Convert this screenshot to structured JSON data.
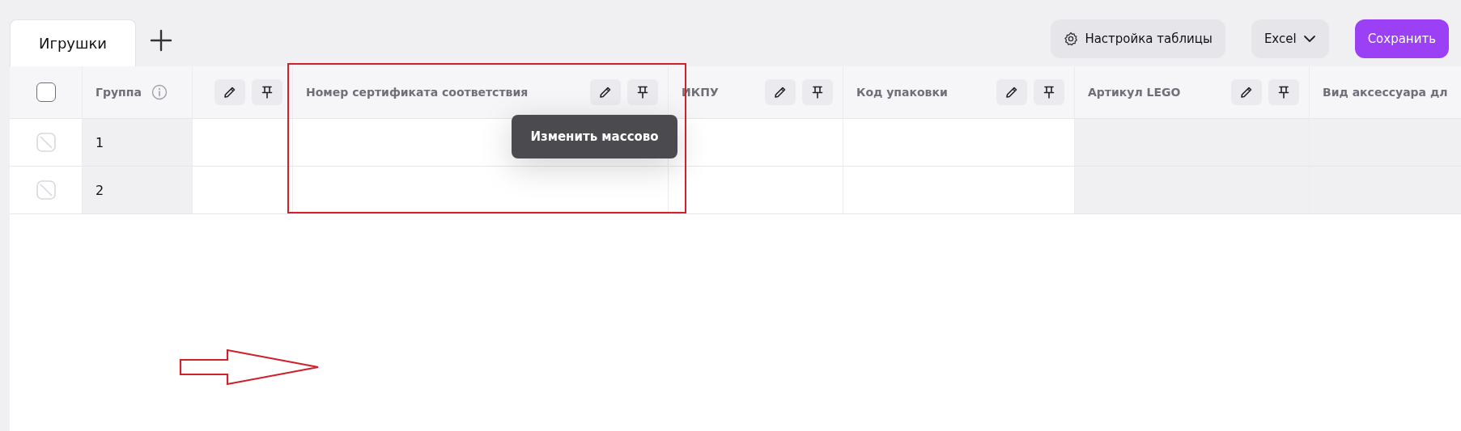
{
  "tabs": [
    {
      "label": "Игрушки",
      "selected": true
    }
  ],
  "toolbar": {
    "settings_button": "Настройка таблицы",
    "export_menu": "Excel",
    "save_button": "Сохранить"
  },
  "table": {
    "header_checkbox": {
      "checked": false
    },
    "columns": [
      {
        "label": "Группа",
        "info": true,
        "actions": false,
        "readonly": true
      },
      {
        "info": false,
        "actions": true,
        "readonly": false
      },
      {
        "label": "Номер сертификата соответствия",
        "info": false,
        "actions": true,
        "readonly": false
      },
      {
        "label": "ИКПУ",
        "info": false,
        "actions": true,
        "readonly": false
      },
      {
        "label": "Код упаковки",
        "info": false,
        "actions": true,
        "readonly": false
      },
      {
        "label": "Артикул LEGO",
        "info": false,
        "actions": true,
        "readonly": true
      },
      {
        "label": "Вид аксессуара дл",
        "info": false,
        "actions": false,
        "readonly": true
      }
    ],
    "rows": [
      {
        "group": "1",
        "disabled": true
      },
      {
        "group": "2",
        "disabled": true
      }
    ]
  },
  "tooltip": {
    "text": "Изменить массово"
  },
  "annotations": [
    {
      "kind": "rectangle"
    },
    {
      "kind": "arrow"
    }
  ]
}
